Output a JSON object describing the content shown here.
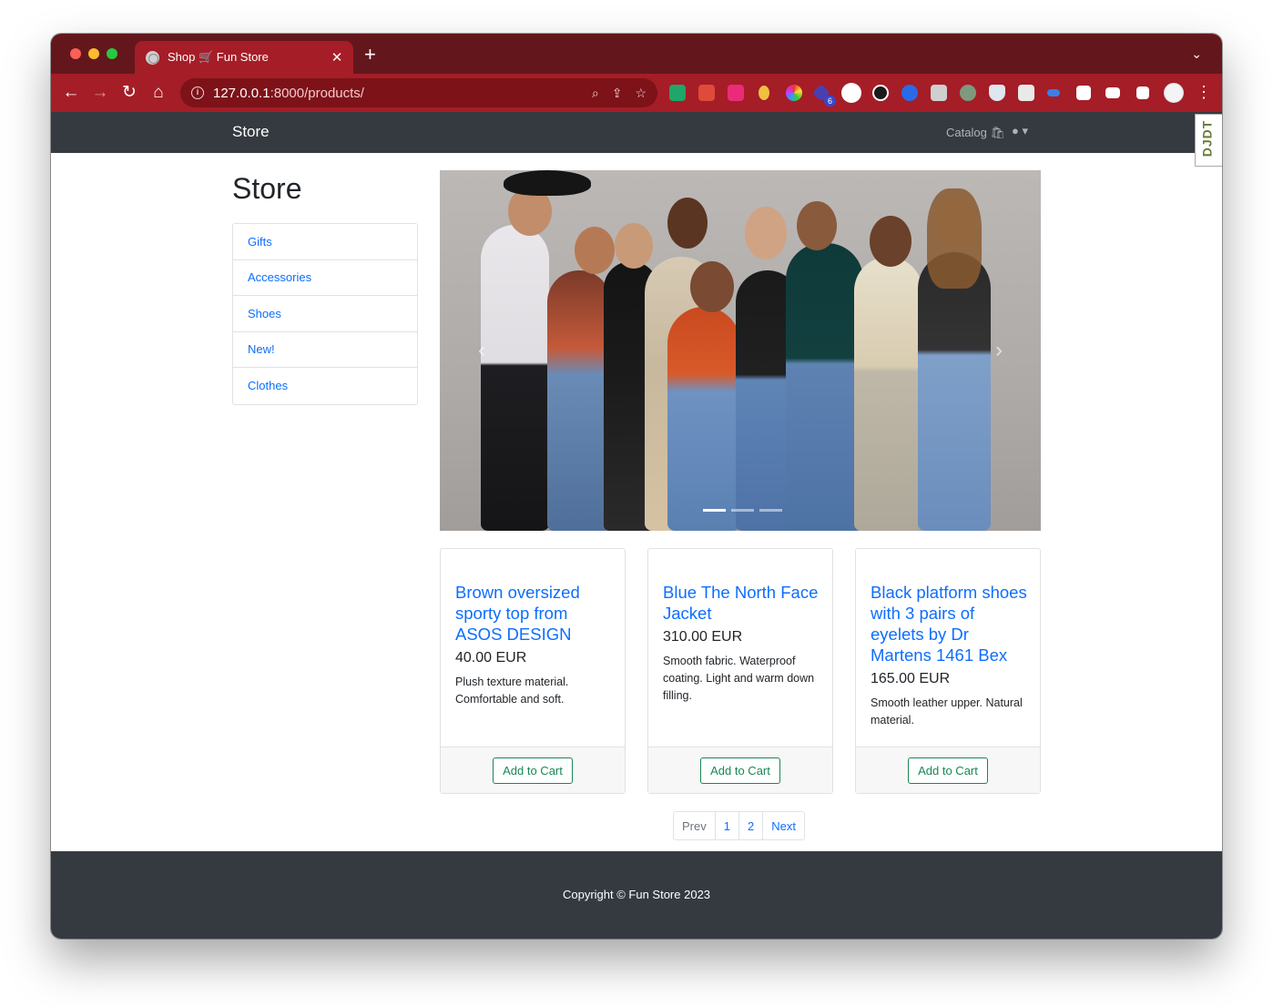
{
  "browser": {
    "tab_title": "Shop 🛒 Fun Store",
    "tab_close": "✕",
    "new_tab": "+",
    "tab_menu": "⌄",
    "url_host": "127.0.0.1",
    "url_path": ":8000/products/",
    "info_icon": "i",
    "nav": {
      "back": "←",
      "forward": "→",
      "reload": "↻",
      "home": "⌂"
    },
    "omni_icons": [
      "⌕",
      "⇪",
      "☆"
    ],
    "menu": "⋮",
    "badge_count": "6"
  },
  "site": {
    "brand": "Store",
    "catalog": "Catalog 🛍",
    "user": "● ▾",
    "djdt": "DJDT"
  },
  "main": {
    "title": "Store",
    "categories": [
      "Gifts",
      "Accessories",
      "Shoes",
      "New!",
      "Clothes"
    ],
    "carousel": {
      "prev": "‹",
      "next": "›"
    },
    "products": [
      {
        "title": "Brown oversized sporty top from ASOS DESIGN",
        "price": "40.00 EUR",
        "desc": "Plush texture material. Comfortable and soft.",
        "button": "Add to Cart"
      },
      {
        "title": "Blue The North Face Jacket",
        "price": "310.00 EUR",
        "desc": "Smooth fabric. Waterproof coating. Light and warm down filling.",
        "button": "Add to Cart"
      },
      {
        "title": "Black platform shoes with 3 pairs of eyelets by Dr Martens 1461 Bex",
        "price": "165.00 EUR",
        "desc": "Smooth leather upper. Natural material.",
        "button": "Add to Cart"
      }
    ],
    "pagination": [
      "Prev",
      "1",
      "2",
      "Next"
    ]
  },
  "footer": {
    "text": "Copyright © Fun Store 2023"
  },
  "colors": {
    "tabstrip": "#63171c",
    "toolbar": "#a51d27",
    "navbar": "#343a40",
    "link": "#0d6efd",
    "success": "#198754"
  }
}
